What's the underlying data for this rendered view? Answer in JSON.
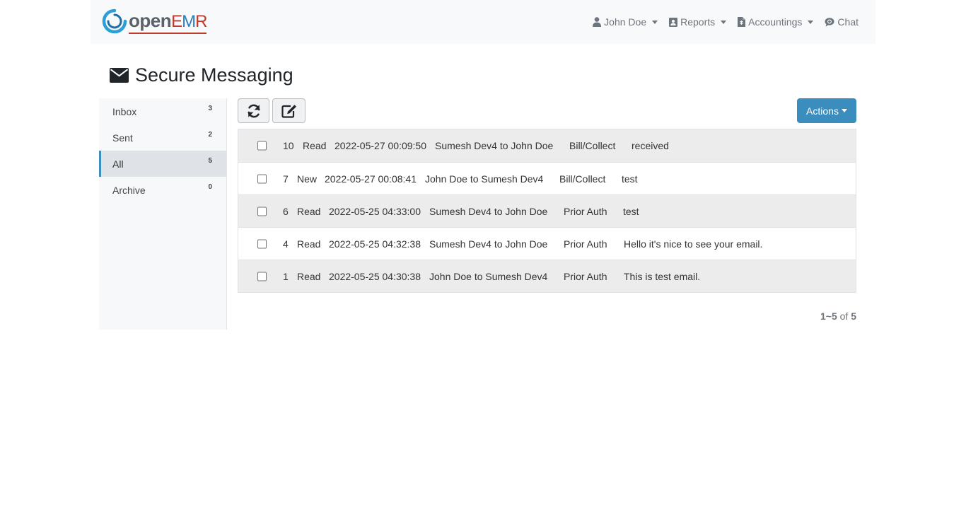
{
  "brand": {
    "open_text": "open",
    "emr_e": "E",
    "emr_m": "M",
    "emr_r": "R"
  },
  "nav": {
    "user": "John Doe",
    "reports": "Reports",
    "accountings": "Accountings",
    "chat": "Chat"
  },
  "page": {
    "title": "Secure Messaging"
  },
  "folders": [
    {
      "label": "Inbox",
      "count": "3"
    },
    {
      "label": "Sent",
      "count": "2"
    },
    {
      "label": "All",
      "count": "5"
    },
    {
      "label": "Archive",
      "count": "0"
    }
  ],
  "toolbar": {
    "actions_label": "Actions"
  },
  "messages": [
    {
      "id": "10",
      "status": "Read",
      "date": "2022-05-27 00:09:50",
      "route": "Sumesh Dev4 to John Doe",
      "category": "Bill/Collect",
      "subject": "received"
    },
    {
      "id": "7",
      "status": "New",
      "date": "2022-05-27 00:08:41",
      "route": "John Doe to Sumesh Dev4",
      "category": "Bill/Collect",
      "subject": "test"
    },
    {
      "id": "6",
      "status": "Read",
      "date": "2022-05-25 04:33:00",
      "route": "Sumesh Dev4 to John Doe",
      "category": "Prior Auth",
      "subject": "test"
    },
    {
      "id": "4",
      "status": "Read",
      "date": "2022-05-25 04:32:38",
      "route": "Sumesh Dev4 to John Doe",
      "category": "Prior Auth",
      "subject": "Hello it's nice to see your email."
    },
    {
      "id": "1",
      "status": "Read",
      "date": "2022-05-25 04:30:38",
      "route": "John Doe to Sumesh Dev4",
      "category": "Prior Auth",
      "subject": "This is test email."
    }
  ],
  "pagination": {
    "range": "1~5",
    "of": "of",
    "total": "5"
  },
  "colors": {
    "accent": "#3b8dbd",
    "logo_red": "#c0392b",
    "logo_blue": "#2b7fc0",
    "navbar_bg": "#f8f9fa",
    "row_stripe": "#ececec"
  }
}
